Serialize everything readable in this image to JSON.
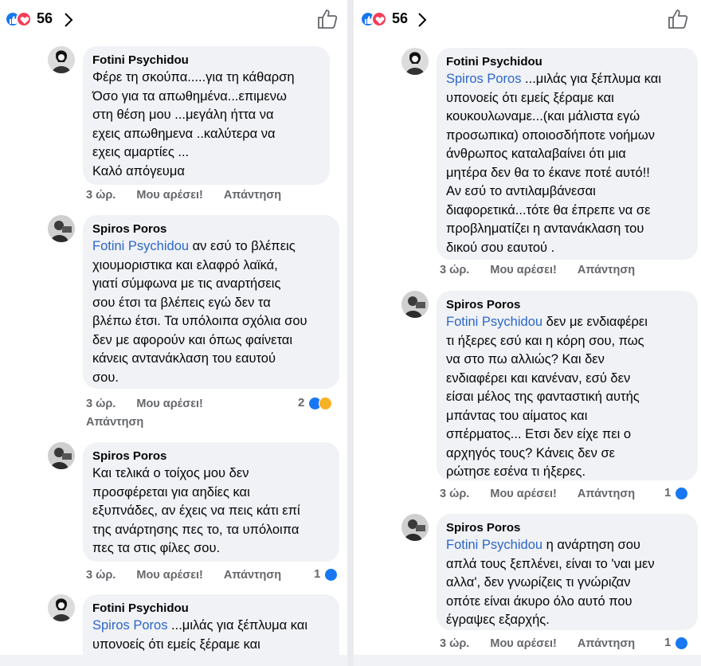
{
  "left": {
    "header": {
      "reaction_count": "56"
    },
    "comments": [
      {
        "author": "Fotini Psychidou",
        "mention": "",
        "text": "Φέρε τη σκούπα.....για τη κάθαρση\nΌσο για τα απωθημένα...επιμενω\nστη θέση μου ...μεγάλη ήττα να\nεχεις απωθημενα ..καλύτερα να\nεχεις αμαρτίες ...\nΚαλό απόγευμα",
        "time": "3 ώρ.",
        "like": "Μου αρέσει!",
        "reply": "Απάντηση"
      },
      {
        "author": "Spiros Poros",
        "mention": "Fotini Psychidou",
        "text": " αν εσύ το βλέπεις\nχιουμοριστικα και ελαφρό λαϊκά,\nγιατί σύμφωνα με τις αναρτήσεις\nσου έτσι τα βλέπεις εγώ δεν τα\nβλέπω έτσι. Τα υπόλοιπα σχόλια σου\nδεν με αφορούν και όπως φαίνεται\nκάνεις αντανάκλαση του εαυτού\nσου.",
        "time": "3 ώρ.",
        "like": "Μου αρέσει!",
        "reply": "Απάντηση",
        "reactions": "2"
      },
      {
        "author": "Spiros Poros",
        "mention": "",
        "text": "Και τελικά ο τοίχος μου δεν\nπροσφέρεται για αηδίες και\nεξυπνάδες, αν έχεις να πεις κάτι επί\nτης ανάρτησης πες το, τα υπόλοιπα\nπες τα στις φίλες σου.",
        "time": "3 ώρ.",
        "like": "Μου αρέσει!",
        "reply": "Απάντηση",
        "reactions": "1"
      },
      {
        "author": "Fotini Psychidou",
        "mention": "Spiros Poros",
        "text": " ...μιλάς για ξέπλυμα και\nυπονοείς ότι εμείς ξέραμε και",
        "time": "",
        "like": "",
        "reply": ""
      }
    ]
  },
  "right": {
    "header": {
      "reaction_count": "56"
    },
    "comments": [
      {
        "author": "Fotini Psychidou",
        "mention": "Spiros Poros",
        "text": " ...μιλάς για ξέπλυμα και\nυπονοείς ότι εμείς ξέραμε και\nκουκουλωναμε...(και μάλιστα εγώ\nπροσωπικα) οποιοσδήποτε νοήμων\nάνθρωπος καταλαβαίνει ότι μια\nμητέρα δεν θα το έκανε ποτέ αυτό!!\nΑν εσύ το αντιλαμβάνεσαι\nδιαφορετικά...τότε θα έπρεπε να σε\nπροβληματίζει η αντανάκλαση του\nδικού σου εαυτού .",
        "time": "3 ώρ.",
        "like": "Μου αρέσει!",
        "reply": "Απάντηση"
      },
      {
        "author": "Spiros Poros",
        "mention": "Fotini Psychidou",
        "text": " δεν με ενδιαφέρει\nτι ήξερες εσύ και η κόρη σου, πως\nνα στο πω αλλιώς? Και δεν\nενδιαφέρει και κανέναν, εσύ δεν\nείσαι μέλος της φανταστική αυτής\nμπάντας του αίματος και\nσπέρματος... Ετσι δεν είχε πει ο\nαρχηγός τους? Κάνεις δεν σε\nρώτησε εσένα τι ήξερες.",
        "time": "3 ώρ.",
        "like": "Μου αρέσει!",
        "reply": "Απάντηση",
        "reactions": "1"
      },
      {
        "author": "Spiros Poros",
        "mention": "Fotini Psychidou",
        "text": " η ανάρτηση σου\nαπλά τους ξεπλένει, είναι το 'ναι μεν\nαλλα', δεν γνωρίζεις τι γνώριζαν\nοπότε είναι άκυρο όλο αυτό που\nέγραψες εξαρχής.",
        "time": "3 ώρ.",
        "like": "Μου αρέσει!",
        "reply": "Απάντηση",
        "reactions": "1"
      }
    ]
  }
}
